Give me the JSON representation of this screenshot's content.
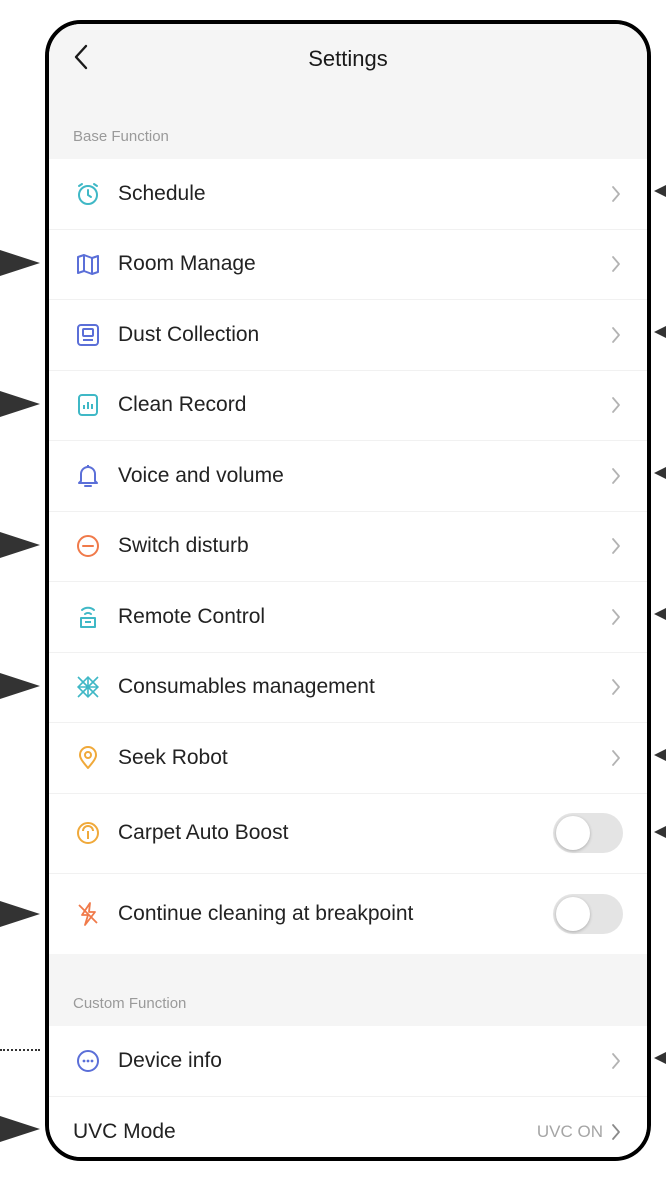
{
  "header": {
    "title": "Settings"
  },
  "sections": {
    "base": "Base Function",
    "custom": "Custom Function"
  },
  "base_items": [
    {
      "label": "Schedule",
      "icon": "alarm-clock-icon",
      "color": "#3fb8c6"
    },
    {
      "label": "Room Manage",
      "icon": "map-icon",
      "color": "#5b6fd8"
    },
    {
      "label": "Dust Collection",
      "icon": "dust-station-icon",
      "color": "#5b6fd8"
    },
    {
      "label": "Clean Record",
      "icon": "record-chart-icon",
      "color": "#3fb8c6"
    },
    {
      "label": "Voice and volume",
      "icon": "bell-icon",
      "color": "#5b6fd8"
    },
    {
      "label": "Switch disturb",
      "icon": "do-not-disturb-icon",
      "color": "#f07a4a"
    },
    {
      "label": "Remote Control",
      "icon": "remote-control-icon",
      "color": "#3fb8c6"
    },
    {
      "label": "Consumables management",
      "icon": "consumables-icon",
      "color": "#3fb8c6"
    },
    {
      "label": "Seek Robot",
      "icon": "location-pin-icon",
      "color": "#f0a93a"
    },
    {
      "label": "Carpet Auto Boost",
      "icon": "carpet-boost-icon",
      "color": "#f0a93a",
      "toggle": false
    },
    {
      "label": "Continue cleaning at breakpoint",
      "icon": "breakpoint-icon",
      "color": "#f07a4a",
      "toggle": false
    }
  ],
  "custom_items": [
    {
      "label": "Device info",
      "icon": "more-dots-icon",
      "color": "#5b6fd8"
    },
    {
      "label": "UVC Mode",
      "value": "UVC ON"
    }
  ]
}
